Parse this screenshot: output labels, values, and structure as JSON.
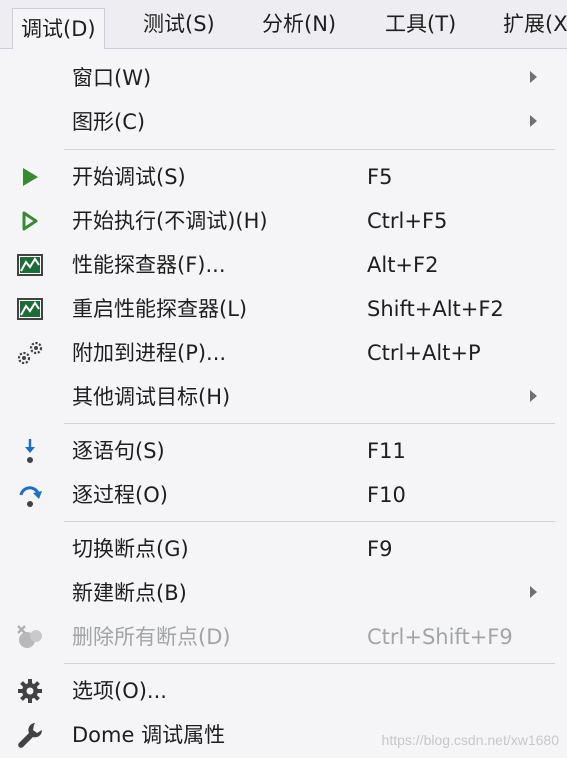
{
  "menubar": {
    "items": [
      {
        "label": "调试(D)"
      },
      {
        "label": "测试(S)"
      },
      {
        "label": "分析(N)"
      },
      {
        "label": "工具(T)"
      },
      {
        "label": "扩展(X)"
      }
    ]
  },
  "menu": {
    "items": [
      {
        "label": "窗口(W)",
        "shortcut": "",
        "icon": "",
        "submenu": true
      },
      {
        "label": "图形(C)",
        "shortcut": "",
        "icon": "",
        "submenu": true
      },
      {
        "label": "开始调试(S)",
        "shortcut": "F5",
        "icon": "play-solid-icon"
      },
      {
        "label": "开始执行(不调试)(H)",
        "shortcut": "Ctrl+F5",
        "icon": "play-outline-icon"
      },
      {
        "label": "性能探查器(F)...",
        "shortcut": "Alt+F2",
        "icon": "performance-profiler-icon"
      },
      {
        "label": "重启性能探查器(L)",
        "shortcut": "Shift+Alt+F2",
        "icon": "restart-profiler-icon"
      },
      {
        "label": "附加到进程(P)...",
        "shortcut": "Ctrl+Alt+P",
        "icon": "attach-process-gears-icon"
      },
      {
        "label": "其他调试目标(H)",
        "shortcut": "",
        "icon": "",
        "submenu": true
      },
      {
        "label": "逐语句(S)",
        "shortcut": "F11",
        "icon": "step-into-icon"
      },
      {
        "label": "逐过程(O)",
        "shortcut": "F10",
        "icon": "step-over-icon"
      },
      {
        "label": "切换断点(G)",
        "shortcut": "F9",
        "icon": ""
      },
      {
        "label": "新建断点(B)",
        "shortcut": "",
        "icon": "",
        "submenu": true
      },
      {
        "label": "删除所有断点(D)",
        "shortcut": "Ctrl+Shift+F9",
        "icon": "delete-breakpoints-icon",
        "disabled": true
      },
      {
        "label": "选项(O)...",
        "shortcut": "",
        "icon": "options-gear-icon"
      },
      {
        "label": "Dome 调试属性",
        "shortcut": "",
        "icon": "wrench-icon"
      }
    ]
  },
  "watermark": "https://blog.csdn.net/xw1680",
  "colors": {
    "play_green": "#388a34",
    "step_blue": "#1e6fc0",
    "disabled": "#a2a4a5",
    "menu_bg": "#f5f5f7"
  }
}
